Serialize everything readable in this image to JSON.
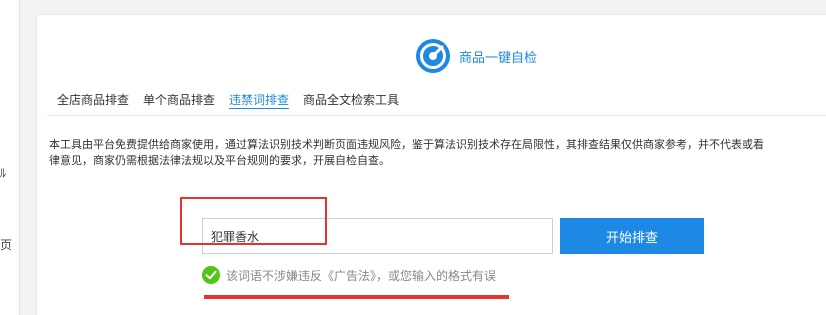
{
  "left_strip": {
    "fragments": [
      "ﾙ",
      "页"
    ]
  },
  "header": {
    "title": "商品一键自检",
    "logo_icon": "target-gauge-icon"
  },
  "tabs": [
    {
      "label": "全店商品排查",
      "active": false
    },
    {
      "label": "单个商品排查",
      "active": false
    },
    {
      "label": "违禁词排查",
      "active": true
    },
    {
      "label": "商品全文检索工具",
      "active": false
    }
  ],
  "notice": {
    "line1": "本工具由平台免费提供给商家使用，通过算法识别技术判断页面违规风险，鉴于算法识别技术存在局限性，其排查结果仅供商家参考，并不代表或看",
    "line2": "律意见，商家仍需根据法律法规以及平台规则的要求，开展自检自查。"
  },
  "search": {
    "value": "犯罪香水",
    "button_label": "开始排查"
  },
  "result": {
    "icon": "check-circle-icon",
    "text": "该词语不涉嫌违反《广告法》，或您输入的格式有误"
  },
  "colors": {
    "accent": "#1e88e5",
    "success": "#52c41a",
    "annotation": "#e8322f"
  }
}
